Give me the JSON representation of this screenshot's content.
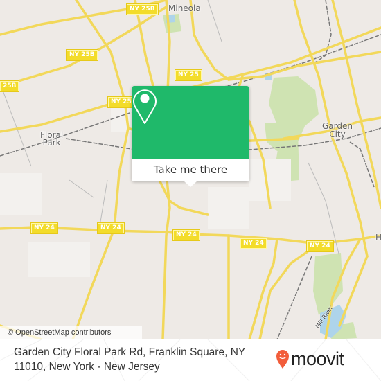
{
  "map": {
    "place_labels": {
      "mineola": "Mineola",
      "floral_park": "Floral\nPark",
      "garden_city": "Garden\nCity",
      "h_partial": "H"
    },
    "road_shields": {
      "ny25b_top": "NY 25B",
      "ny25b_mid": "NY 25B",
      "ny25b_left": "25B",
      "ny25_a": "NY 25",
      "ny25_b": "NY 25",
      "ny24_a": "NY 24",
      "ny24_b": "NY 24",
      "ny24_c": "NY 24",
      "ny24_d": "NY 24",
      "ny24_e": "NY 24"
    },
    "water_label": "Mill River",
    "attribution": "© OpenStreetMap contributors",
    "colors": {
      "land": "#eeeae6",
      "road": "#f7e27a",
      "park": "#c8dfa8",
      "water": "#a9d3ea"
    }
  },
  "popup": {
    "icon": "location-pin-icon",
    "button_label": "Take me there",
    "accent_color": "#1fb96a"
  },
  "footer": {
    "address": "Garden City Floral Park Rd, Franklin Square, NY 11010, New York - New Jersey",
    "brand": "moovit",
    "brand_color": "#f25d3b"
  }
}
